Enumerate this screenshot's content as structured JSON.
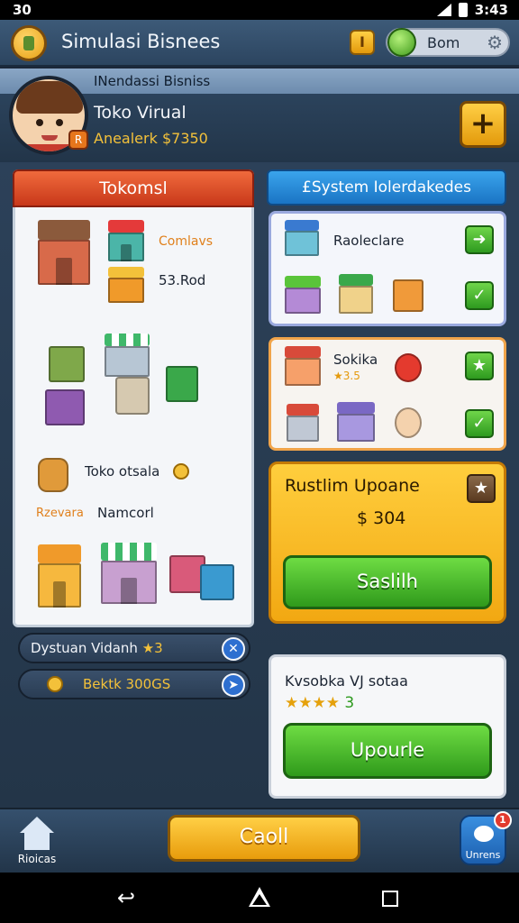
{
  "status_bar": {
    "left": "30",
    "time": "3:43"
  },
  "app": {
    "title": "Simulasi Bisnees",
    "coin_button": "I",
    "pill_label": "Bom"
  },
  "profile": {
    "header": "INendassi Bisniss",
    "shop_name": "Toko Virual",
    "balance": "Anealerk $7350",
    "badge": "R"
  },
  "left": {
    "header": "Tokomsl",
    "item1_label": "Comlavs",
    "item2_label": "53.Rod",
    "item3_label": "Toko otsala",
    "item4_prefix": "Rzevara",
    "item4_label": "Namcorl",
    "rows": [
      {
        "label": "Dystuan Vidanh",
        "suffix": "★3"
      },
      {
        "label": "Bektk 300GS"
      }
    ]
  },
  "right": {
    "header": "£System Iolerdakedes",
    "card_a": {
      "label": "Raoleclare"
    },
    "card_b": {
      "label": "Sokika",
      "stars": "★3.5"
    },
    "card_c": {
      "title": "Rustlim Upoane",
      "price": "$ 304",
      "button": "Saslilh"
    },
    "card_d": {
      "title": "Kvsobka VJ sotaa",
      "stars": "★★★★",
      "star_count": "3",
      "button": "Upourle"
    }
  },
  "bottom": {
    "home_label": "Rioicas",
    "cta": "Caoll",
    "messages_label": "Unrens",
    "badge": "1"
  },
  "colors": {
    "accent_orange": "#f06a3c",
    "accent_blue": "#1a74c4",
    "gold": "#f2a812",
    "green": "#2f9a1b"
  }
}
